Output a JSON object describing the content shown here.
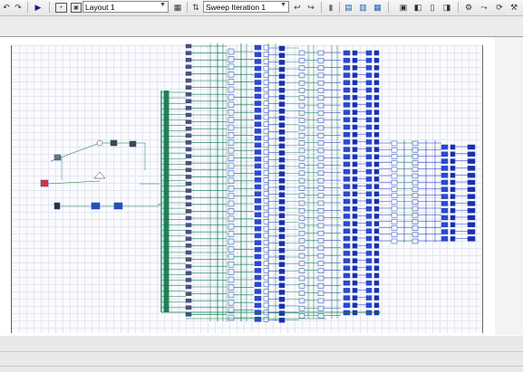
{
  "toolbar": {
    "layout_select": "Layout 1",
    "sweep_select": "Sweep Iteration 1"
  },
  "diagram": {
    "wire_color_main": "#0a7a4a",
    "wire_color_blue": "#1a2fc0",
    "component_color": "#1f3fbf"
  }
}
